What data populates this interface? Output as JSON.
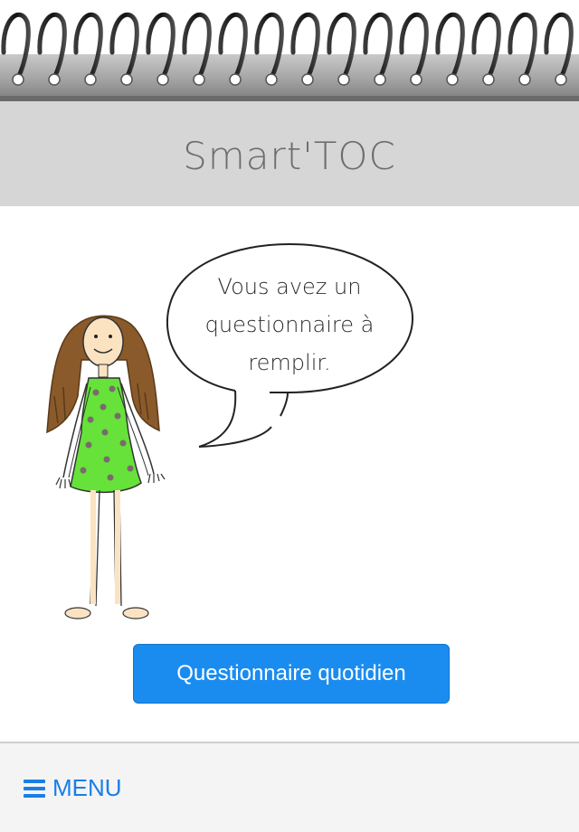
{
  "header": {
    "title": "Smart'TOC"
  },
  "speech_bubble": {
    "lines": [
      "Vous avez un",
      "questionnaire à",
      "remplir."
    ]
  },
  "character": {
    "description_icon": "girl-illustration-icon"
  },
  "actions": {
    "questionnaire_button_label": "Questionnaire quotidien"
  },
  "footer": {
    "menu_label": "MENU",
    "menu_icon": "hamburger-icon"
  },
  "colors": {
    "header_bg": "#d6d6d6",
    "accent_blue": "#1a8cf0",
    "menu_blue": "#1a7ee6",
    "dress_green": "#66e23a",
    "hair_brown": "#8a5a2b"
  }
}
